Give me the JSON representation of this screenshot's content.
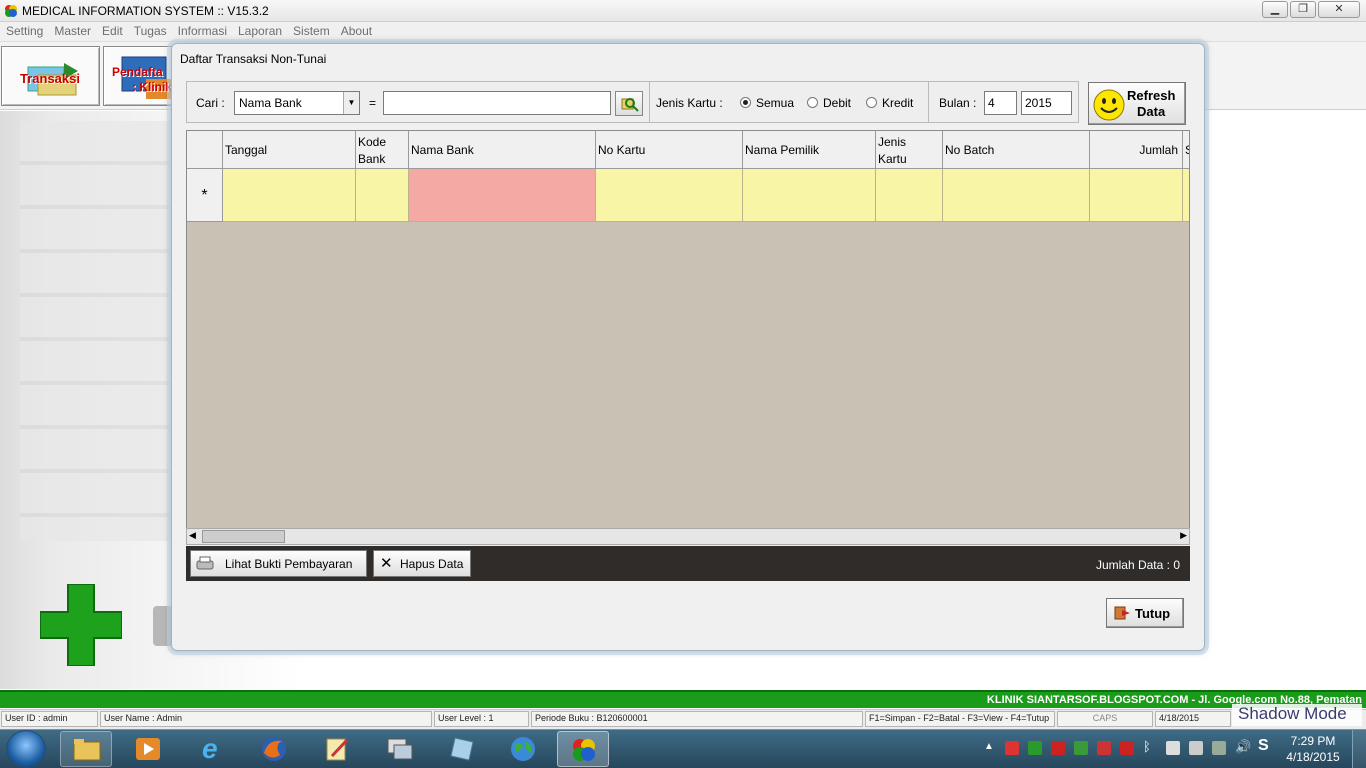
{
  "app": {
    "title": "MEDICAL INFORMATION SYSTEM :: V15.3.2",
    "window_controls": [
      "minimize",
      "restore",
      "close"
    ]
  },
  "menu": [
    "Setting",
    "Master",
    "Edit",
    "Tugas",
    "Informasi",
    "Laporan",
    "Sistem",
    "About"
  ],
  "toolbar": {
    "transaksi_label": "Transaksi",
    "pendaftaran_label": "Pendafta",
    "klinik_label": ": Klinik"
  },
  "dialog": {
    "title": "Daftar Transaksi Non-Tunai",
    "filter": {
      "cari_label": "Cari :",
      "cari_field": "Nama Bank",
      "equals": "=",
      "search_value": "",
      "jenis_kartu_label": "Jenis Kartu :",
      "options": [
        "Semua",
        "Debit",
        "Kredit"
      ],
      "selected": "Semua",
      "bulan_label": "Bulan :",
      "month": "4",
      "year": "2015"
    },
    "refresh_label_1": "Refresh",
    "refresh_label_2": "Data",
    "grid": {
      "columns": [
        {
          "line1": "Tanggal",
          "line2": ""
        },
        {
          "line1": "Kode",
          "line2": "Bank"
        },
        {
          "line1": "Nama Bank",
          "line2": ""
        },
        {
          "line1": "No Kartu",
          "line2": ""
        },
        {
          "line1": "Nama Pemilik",
          "line2": ""
        },
        {
          "line1": "Jenis",
          "line2": "Kartu"
        },
        {
          "line1": "No Batch",
          "line2": ""
        },
        {
          "line1": "Jumlah",
          "line2": ""
        },
        {
          "line1": "S",
          "line2": ""
        }
      ],
      "new_row_marker": "*",
      "rows": []
    },
    "lihat_bukti_label": "Lihat Bukti Pembayaran",
    "hapus_label": "Hapus Data",
    "jumlah_data": "Jumlah Data : 0",
    "tutup_label": "Tutup"
  },
  "marquee": "KLINIK SIANTARSOF.BLOGSPOT.COM - Jl. Google.com No.88, Pematan",
  "status": {
    "user_id": "User ID : admin",
    "user_name": "User Name : Admin",
    "user_level": "User Level : 1",
    "periode": "Periode Buku : B120600001",
    "shortcuts": "F1=Simpan - F2=Batal - F3=View - F4=Tutup",
    "caps": "CAPS",
    "date": "4/18/2015"
  },
  "overlay": "Shadow Mode",
  "taskbar": {
    "time": "7:29 PM",
    "date": "4/18/2015"
  },
  "colors": {
    "grid_new_row": "#f8f5a6",
    "grid_selected_cell": "#f4a9a4",
    "grid_background": "#c9c2b4",
    "action_bar": "#2f2c2a",
    "status_band": "#1a9b1a"
  }
}
